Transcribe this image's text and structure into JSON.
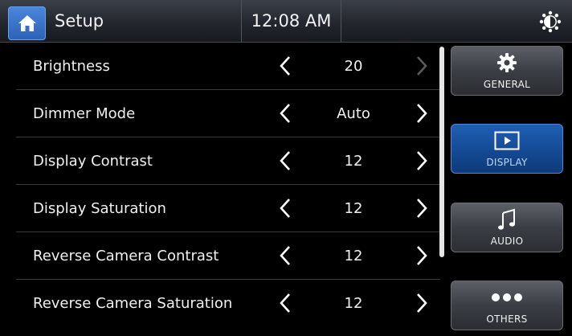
{
  "header": {
    "title": "Setup",
    "time": "12:08 AM",
    "home_icon": "home-icon",
    "brightness_icon": "brightness-icon"
  },
  "settings": [
    {
      "label": "Brightness",
      "value": "20",
      "right_enabled": false
    },
    {
      "label": "Dimmer Mode",
      "value": "Auto",
      "right_enabled": true
    },
    {
      "label": "Display Contrast",
      "value": "12",
      "right_enabled": true
    },
    {
      "label": "Display Saturation",
      "value": "12",
      "right_enabled": true
    },
    {
      "label": "Reverse Camera Contrast",
      "value": "12",
      "right_enabled": true
    },
    {
      "label": "Reverse Camera Saturation",
      "value": "12",
      "right_enabled": true
    }
  ],
  "sidebar": {
    "items": [
      {
        "label": "GENERAL",
        "icon": "gear-icon",
        "active": false
      },
      {
        "label": "DISPLAY",
        "icon": "display-icon",
        "active": true
      },
      {
        "label": "AUDIO",
        "icon": "music-note-icon",
        "active": false
      },
      {
        "label": "OTHERS",
        "icon": "more-dots-icon",
        "active": false
      }
    ]
  },
  "colors": {
    "accent": "#2c63b8",
    "background": "#000000",
    "text": "#f0f0f0",
    "disabled_arrow": "#5a5a5a"
  }
}
